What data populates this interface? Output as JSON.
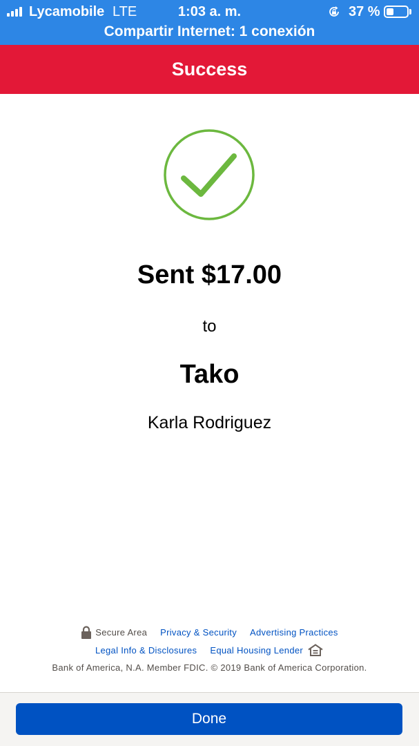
{
  "status_bar": {
    "carrier": "Lycamobile",
    "network": "LTE",
    "time": "1:03 a. m.",
    "battery_percent": "37 %",
    "battery_level": 0.37,
    "hotspot": "Compartir Internet: 1 conexión",
    "icons": [
      "signal-bars-icon",
      "rotation-lock-icon",
      "battery-icon"
    ],
    "color": "#2d86e5"
  },
  "header": {
    "title": "Success",
    "color": "#e31837"
  },
  "main": {
    "check_icon": "checkmark-circle-icon",
    "check_color": "#6cb83f",
    "sent_amount": "Sent $17.00",
    "to_label": "to",
    "recipient_name": "Tako",
    "recipient_full_name": "Karla Rodriguez"
  },
  "footer": {
    "secure_area": "Secure Area",
    "privacy_security": "Privacy & Security",
    "advertising_practices": "Advertising Practices",
    "legal_info": "Legal Info & Disclosures",
    "equal_housing": "Equal Housing Lender",
    "copyright": "Bank of America, N.A. Member FDIC. © 2019 Bank of America Corporation.",
    "icons": [
      "padlock-icon",
      "equal-housing-icon"
    ],
    "link_color": "#0052c2"
  },
  "actions": {
    "done_label": "Done",
    "button_color": "#0052c2"
  }
}
